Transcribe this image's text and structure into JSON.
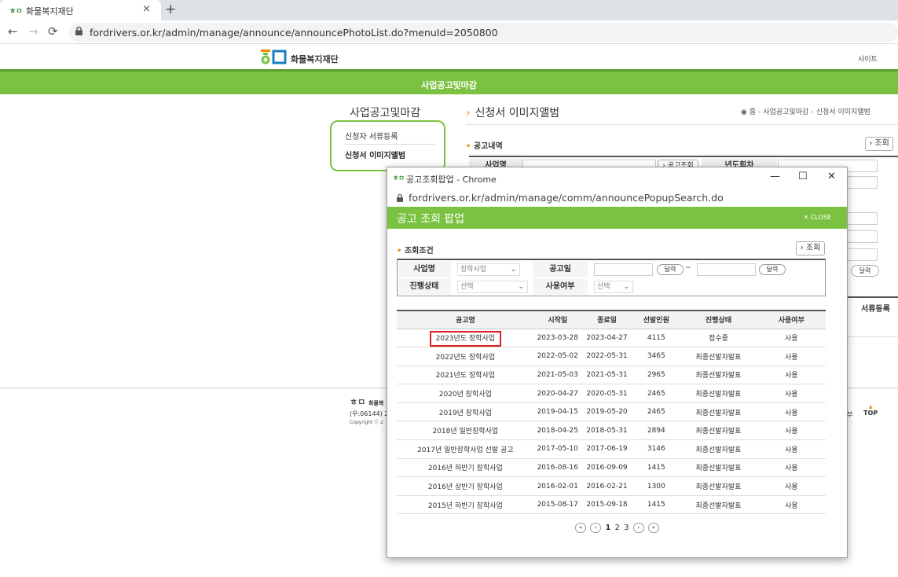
{
  "browser": {
    "tab_title": "화물복지재단",
    "tab_close": "×",
    "new_tab": "+",
    "url": "fordrivers.or.kr/admin/manage/announce/announcePhotoList.do?menuId=2050800"
  },
  "site": {
    "logo_text": "화물복지재단",
    "top_right": "사이트",
    "green_title": "사업공고및마감"
  },
  "left_menu": {
    "title": "사업공고및마감",
    "items": [
      "신청자 서류등록",
      "신청서 이미지앨범"
    ]
  },
  "main": {
    "title": "신청서 이미지앨범",
    "breadcrumb": {
      "home": "홈",
      "b1": "사업공고및마감",
      "b2": "신청서 이미지앨범"
    },
    "section": "공고내역",
    "search_btn": "조회",
    "lbl_name": "사업명",
    "btn_lookup": "공고조회",
    "lbl_year": "년도회차",
    "cal_btn": "달력",
    "reg_label": "서류등록"
  },
  "footer": {
    "logo": "화물복",
    "addr": "(우:06144) 2",
    "copy": "Copyright ⓒ 2",
    "right": "부",
    "top": "TOP"
  },
  "popup": {
    "window_title": "공고조회팝업 - Chrome",
    "url": "fordrivers.or.kr/admin/manage/comm/announcePopupSearch.do",
    "header": "공고 조회 팝업",
    "close": "CLOSE",
    "cond_title": "조회조건",
    "search_btn": "조회",
    "form": {
      "lbl_name": "사업명",
      "sel_name": "장학사업",
      "lbl_date": "공고일",
      "cal": "달력",
      "tilde": "~",
      "lbl_status": "진행상태",
      "sel_status": "선택",
      "lbl_use": "사용여부",
      "sel_use": "선택"
    },
    "columns": [
      "공고명",
      "시작일",
      "종료일",
      "선발인원",
      "진행상태",
      "사용여부"
    ],
    "rows": [
      [
        "2023년도 장학사업",
        "2023-03-28",
        "2023-04-27",
        "4115",
        "접수중",
        "사용"
      ],
      [
        "2022년도 장학사업",
        "2022-05-02",
        "2022-05-31",
        "3465",
        "최종선발자발표",
        "사용"
      ],
      [
        "2021년도 장학사업",
        "2021-05-03",
        "2021-05-31",
        "2965",
        "최종선발자발표",
        "사용"
      ],
      [
        "2020년 장학사업",
        "2020-04-27",
        "2020-05-31",
        "2465",
        "최종선발자발표",
        "사용"
      ],
      [
        "2019년 장학사업",
        "2019-04-15",
        "2019-05-20",
        "2465",
        "최종선발자발표",
        "사용"
      ],
      [
        "2018년 일반장학사업",
        "2018-04-25",
        "2018-05-31",
        "2894",
        "최종선발자발표",
        "사용"
      ],
      [
        "2017년 일반장학사업 선발 공고",
        "2017-05-10",
        "2017-06-19",
        "3146",
        "최종선발자발표",
        "사용"
      ],
      [
        "2016년 하반기 장학사업",
        "2016-08-16",
        "2016-09-09",
        "1415",
        "최종선발자발표",
        "사용"
      ],
      [
        "2016년 상반기 장학사업",
        "2016-02-01",
        "2016-02-21",
        "1300",
        "최종선발자발표",
        "사용"
      ],
      [
        "2015년 하반기 장학사업",
        "2015-08-17",
        "2015-09-18",
        "1415",
        "최종선발자발표",
        "사용"
      ]
    ],
    "pager": {
      "first": "«",
      "prev": "‹",
      "pages": [
        "1",
        "2",
        "3"
      ],
      "next": "›",
      "last": "»"
    }
  }
}
